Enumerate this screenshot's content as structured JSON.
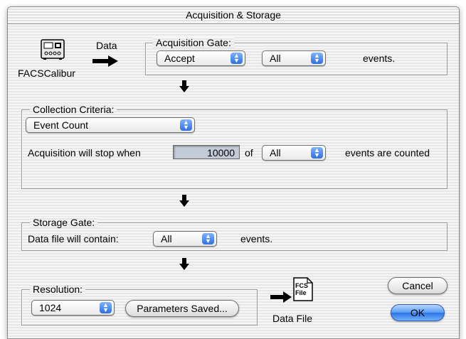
{
  "window": {
    "title": "Acquisition & Storage"
  },
  "instrument": {
    "label": "FACSCalibur",
    "flow_label": "Data"
  },
  "acquisition_gate": {
    "legend": "Acquisition Gate:",
    "mode": "Accept",
    "gate": "All",
    "suffix": "events."
  },
  "collection_criteria": {
    "legend": "Collection Criteria:",
    "criterion": "Event Count",
    "stop_prefix": "Acquisition will stop when",
    "count_value": "10000",
    "of_label": "of",
    "gate": "All",
    "suffix": "events are counted"
  },
  "storage_gate": {
    "legend": "Storage Gate:",
    "prefix": "Data file will contain:",
    "gate": "All",
    "suffix": "events."
  },
  "resolution": {
    "legend": "Resolution:",
    "value": "1024",
    "params_button": "Parameters Saved..."
  },
  "data_file": {
    "icon_text_1": "FCS",
    "icon_text_2": "File",
    "label": "Data File"
  },
  "buttons": {
    "cancel": "Cancel",
    "ok": "OK"
  }
}
